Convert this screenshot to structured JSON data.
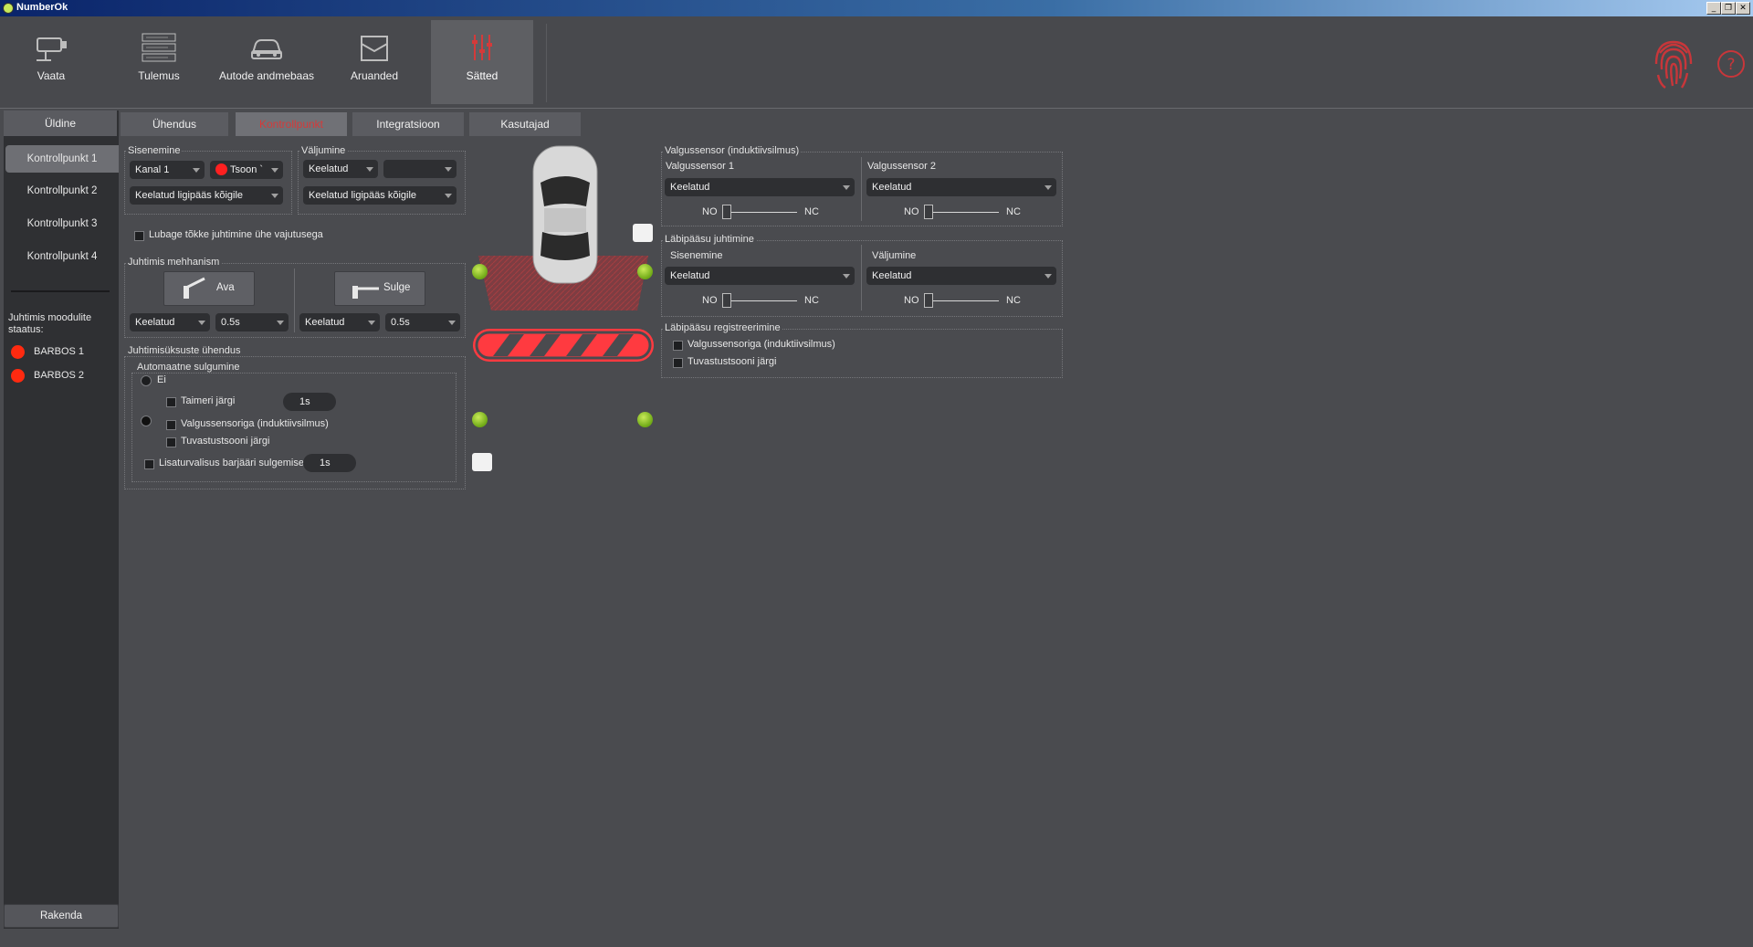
{
  "window": {
    "title": "NumberOk"
  },
  "toolbar": {
    "items": [
      {
        "label": "Vaata",
        "icon": "camera-icon"
      },
      {
        "label": "Tulemus",
        "icon": "results-list-icon"
      },
      {
        "label": "Autode andmebaas",
        "icon": "car-database-icon"
      },
      {
        "label": "Aruanded",
        "icon": "reports-icon"
      },
      {
        "label": "Sätted",
        "icon": "settings-sliders-icon"
      }
    ],
    "active": "Sätted"
  },
  "left_tab": "Üldine",
  "tabs": [
    "Ühendus",
    "Kontrollpunkt",
    "Integratsioon",
    "Kasutajad"
  ],
  "active_tab": "Kontrollpunkt",
  "checkpoints": [
    "Kontrollpunkt 1",
    "Kontrollpunkt 2",
    "Kontrollpunkt 3",
    "Kontrollpunkt 4"
  ],
  "module_status": {
    "title": "Juhtimis moodulite staatus:",
    "items": [
      {
        "label": "BARBOS 1",
        "color": "#ff2a10"
      },
      {
        "label": "BARBOS 2",
        "color": "#ff2a10"
      }
    ]
  },
  "apply_label": "Rakenda",
  "entry": {
    "title": "Sisenemine",
    "channel": "Kanal 1",
    "zone": "Tsoon `",
    "access": "Keelatud ligipääs kõigile"
  },
  "exit": {
    "title": "Väljumine",
    "mode": "Keelatud",
    "second": "",
    "access": "Keelatud ligipääs kõigile"
  },
  "one_press_label": "Lubage tõkke juhtimine ühe vajutusega",
  "mechanism": {
    "title": "Juhtimis mehhanism",
    "open_label": "Ava",
    "close_label": "Sulge",
    "open_mode": "Keelatud",
    "open_time": "0.5s",
    "close_mode": "Keelatud",
    "close_time": "0.5s"
  },
  "devices": {
    "title": "Juhtimisüksuste ühendus",
    "auto_close_title": "Automaatne sulgumine",
    "ei_label": "Ei",
    "timer_label": "Taimeri järgi",
    "timer_value": "1s",
    "loop_label": "Valgussensoriga (induktiivsilmus)",
    "zone_label": "Tuvastustsooni järgi",
    "extra_label": "Lisaturvalisus barjääri sulgemisel",
    "extra_value": "1s"
  },
  "light_sensor": {
    "title": "Valgussensor (induktiivsilmus)",
    "s1_title": "Valgussensor 1",
    "s1_value": "Keelatud",
    "s2_title": "Valgussensor 2",
    "s2_value": "Keelatud",
    "no": "NO",
    "nc": "NC"
  },
  "pass_control": {
    "title": "Läbipääsu juhtimine",
    "entry_title": "Sisenemine",
    "entry_value": "Keelatud",
    "exit_title": "Väljumine",
    "exit_value": "Keelatud",
    "no": "NO",
    "nc": "NC"
  },
  "pass_reg": {
    "title": "Läbipääsu registreerimine",
    "loop_label": "Valgussensoriga (induktiivsilmus)",
    "zone_label": "Tuvastustsooni järgi"
  },
  "colors": {
    "accent": "#d43a3a",
    "status_red": "#ff2a10",
    "sensor_green": "#8cc41e"
  }
}
